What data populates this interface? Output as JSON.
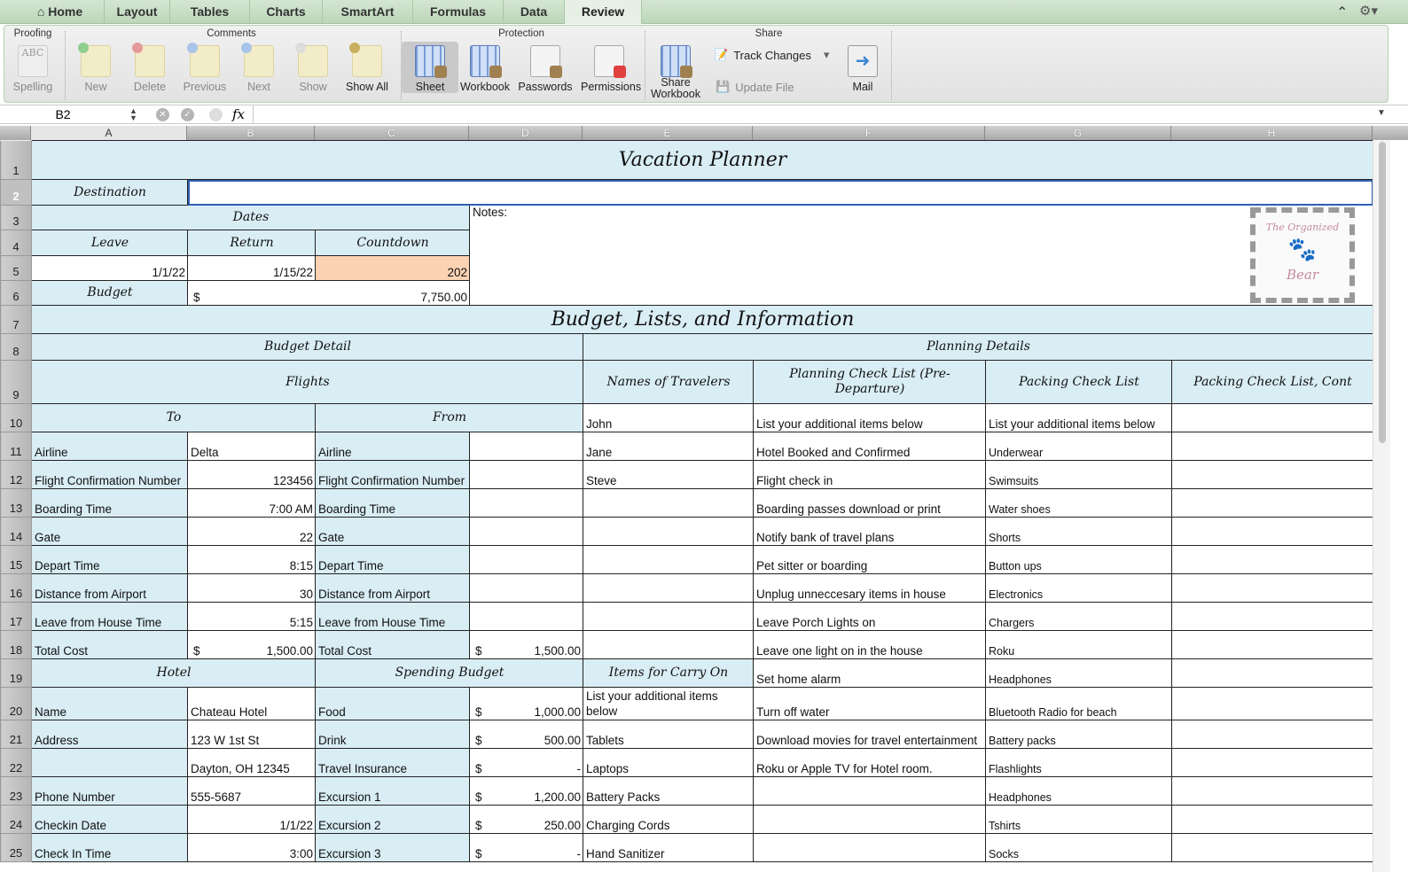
{
  "tabs": [
    "Home",
    "Layout",
    "Tables",
    "Charts",
    "SmartArt",
    "Formulas",
    "Data",
    "Review"
  ],
  "active_tab": "Review",
  "ribbon": {
    "groups": [
      "Proofing",
      "Comments",
      "Protection",
      "Share"
    ],
    "buttons": [
      "Spelling",
      "New",
      "Delete",
      "Previous",
      "Next",
      "Show",
      "Show All",
      "Sheet",
      "Workbook",
      "Passwords",
      "Permissions",
      "Share Workbook",
      "Mail"
    ],
    "track_changes": "Track Changes",
    "update_file": "Update File"
  },
  "formula_bar": {
    "name_box": "B2",
    "fx": "fx",
    "value": ""
  },
  "columns": [
    "A",
    "B",
    "C",
    "D",
    "E",
    "F",
    "G",
    "H"
  ],
  "logo": {
    "line1": "The Organized",
    "line2": "Bear"
  },
  "rows": [
    {
      "n": "1",
      "cells": [
        {
          "t": "Vacation Planner",
          "span": 8,
          "k": "t"
        }
      ]
    },
    {
      "n": "2",
      "cells": [
        {
          "t": "Destination",
          "k": "h"
        },
        {
          "t": "",
          "span": 7,
          "k": "s"
        }
      ]
    },
    {
      "n": "3",
      "cells": [
        {
          "t": "Dates",
          "span": 3,
          "k": "h"
        },
        {
          "t": "Notes:",
          "span": 5,
          "rows": 4,
          "k": "top notes"
        }
      ]
    },
    {
      "n": "4",
      "cells": [
        {
          "t": "Leave",
          "k": "h"
        },
        {
          "t": "Return",
          "k": "h"
        },
        {
          "t": "Countdown",
          "k": "h"
        }
      ]
    },
    {
      "n": "5",
      "cells": [
        {
          "t": "1/1/22",
          "k": "n"
        },
        {
          "t": "1/15/22",
          "k": "n"
        },
        {
          "t": "202",
          "k": "o"
        }
      ]
    },
    {
      "n": "6",
      "cells": [
        {
          "t": "Budget",
          "k": "h"
        },
        {
          "cur": "$",
          "t": "7,750.00",
          "span": 2,
          "k": "n"
        }
      ]
    },
    {
      "n": "7",
      "cells": [
        {
          "t": "Budget, Lists, and Information",
          "span": 8,
          "k": "t"
        }
      ]
    },
    {
      "n": "8",
      "cells": [
        {
          "t": "Budget Detail",
          "span": 4,
          "k": "h"
        },
        {
          "t": "Planning Details",
          "span": 4,
          "k": "h"
        }
      ]
    },
    {
      "n": "9",
      "cells": [
        {
          "t": "Flights",
          "span": 4,
          "k": "h"
        },
        {
          "t": "Names of Travelers",
          "k": "h"
        },
        {
          "t": "Planning Check List (Pre-Departure)",
          "k": "h wrap"
        },
        {
          "t": "Packing Check List",
          "k": "h"
        },
        {
          "t": "Packing Check List, Cont",
          "k": "h"
        }
      ]
    },
    {
      "n": "10",
      "cells": [
        {
          "t": "To",
          "span": 2,
          "k": "h"
        },
        {
          "t": "From",
          "span": 2,
          "k": "h"
        },
        {
          "t": "John"
        },
        {
          "t": "List your additional items below"
        },
        {
          "t": "List your additional items below"
        },
        {
          "t": ""
        }
      ]
    },
    {
      "n": "11",
      "cells": [
        {
          "t": "Airline",
          "k": "b"
        },
        {
          "t": "Delta"
        },
        {
          "t": "Airline",
          "k": "b"
        },
        {
          "t": ""
        },
        {
          "t": "Jane"
        },
        {
          "t": "Hotel Booked and Confirmed"
        },
        {
          "t": "Underwear",
          "k": "g"
        },
        {
          "t": ""
        }
      ]
    },
    {
      "n": "12",
      "cells": [
        {
          "t": "Flight Confirmation Number",
          "k": "b"
        },
        {
          "t": "123456",
          "k": "n"
        },
        {
          "t": "Flight Confirmation Number",
          "k": "b"
        },
        {
          "t": ""
        },
        {
          "t": "Steve"
        },
        {
          "t": "Flight check in"
        },
        {
          "t": "Swimsuits",
          "k": "g"
        },
        {
          "t": ""
        }
      ]
    },
    {
      "n": "13",
      "cells": [
        {
          "t": "Boarding Time",
          "k": "b"
        },
        {
          "t": "7:00 AM",
          "k": "n"
        },
        {
          "t": "Boarding Time",
          "k": "b"
        },
        {
          "t": ""
        },
        {
          "t": ""
        },
        {
          "t": "Boarding passes download or print"
        },
        {
          "t": "Water shoes",
          "k": "g"
        },
        {
          "t": ""
        }
      ]
    },
    {
      "n": "14",
      "cells": [
        {
          "t": "Gate",
          "k": "b"
        },
        {
          "t": "22",
          "k": "n"
        },
        {
          "t": "Gate",
          "k": "b"
        },
        {
          "t": ""
        },
        {
          "t": ""
        },
        {
          "t": "Notify bank of travel plans"
        },
        {
          "t": "Shorts",
          "k": "g"
        },
        {
          "t": ""
        }
      ]
    },
    {
      "n": "15",
      "cells": [
        {
          "t": "Depart Time",
          "k": "b"
        },
        {
          "t": "8:15",
          "k": "n"
        },
        {
          "t": "Depart Time",
          "k": "b"
        },
        {
          "t": ""
        },
        {
          "t": ""
        },
        {
          "t": "Pet sitter or boarding"
        },
        {
          "t": "Button ups",
          "k": "g"
        },
        {
          "t": ""
        }
      ]
    },
    {
      "n": "16",
      "cells": [
        {
          "t": "Distance from Airport",
          "k": "b"
        },
        {
          "t": "30",
          "k": "n"
        },
        {
          "t": "Distance from Airport",
          "k": "b"
        },
        {
          "t": ""
        },
        {
          "t": ""
        },
        {
          "t": "Unplug unneccesary items in house"
        },
        {
          "t": "Electronics",
          "k": "g"
        },
        {
          "t": ""
        }
      ]
    },
    {
      "n": "17",
      "cells": [
        {
          "t": "Leave from House Time",
          "k": "b"
        },
        {
          "t": "5:15",
          "k": "n"
        },
        {
          "t": "Leave from House Time",
          "k": "b"
        },
        {
          "t": ""
        },
        {
          "t": ""
        },
        {
          "t": "Leave Porch Lights on"
        },
        {
          "t": "Chargers",
          "k": "g"
        },
        {
          "t": ""
        }
      ]
    },
    {
      "n": "18",
      "cells": [
        {
          "t": "Total Cost",
          "k": "b"
        },
        {
          "cur": "$",
          "t": "1,500.00",
          "k": "n"
        },
        {
          "t": "Total Cost",
          "k": "b"
        },
        {
          "cur": "$",
          "t": "1,500.00",
          "k": "n"
        },
        {
          "t": ""
        },
        {
          "t": "Leave one light on in the house"
        },
        {
          "t": "Roku",
          "k": "g"
        },
        {
          "t": ""
        }
      ]
    },
    {
      "n": "19",
      "cells": [
        {
          "t": "Hotel",
          "span": 2,
          "k": "h"
        },
        {
          "t": "Spending Budget",
          "span": 2,
          "k": "h"
        },
        {
          "t": "Items for Carry On",
          "k": "h"
        },
        {
          "t": "Set home alarm"
        },
        {
          "t": "Headphones",
          "k": "g"
        },
        {
          "t": ""
        }
      ]
    },
    {
      "n": "20",
      "cells": [
        {
          "t": "Name",
          "k": "b"
        },
        {
          "t": "Chateau Hotel"
        },
        {
          "t": "Food",
          "k": "b"
        },
        {
          "cur": "$",
          "t": "1,000.00",
          "k": "n"
        },
        {
          "t": "List your additional items below",
          "k": "wrap"
        },
        {
          "t": "Turn off water"
        },
        {
          "t": "Bluetooth Radio for beach",
          "k": "g"
        },
        {
          "t": ""
        }
      ]
    },
    {
      "n": "21",
      "cells": [
        {
          "t": "Address",
          "k": "b"
        },
        {
          "t": "123 W 1st St"
        },
        {
          "t": "Drink",
          "k": "b"
        },
        {
          "cur": "$",
          "t": "500.00",
          "k": "n"
        },
        {
          "t": "Tablets"
        },
        {
          "t": "Download movies for travel entertainment"
        },
        {
          "t": "Battery packs",
          "k": "g"
        },
        {
          "t": ""
        }
      ]
    },
    {
      "n": "22",
      "cells": [
        {
          "t": "",
          "k": "b"
        },
        {
          "t": "Dayton, OH 12345"
        },
        {
          "t": "Travel Insurance",
          "k": "b"
        },
        {
          "cur": "$",
          "t": "-",
          "k": "n"
        },
        {
          "t": "Laptops"
        },
        {
          "t": "Roku or Apple TV for Hotel room."
        },
        {
          "t": "Flashlights",
          "k": "g"
        },
        {
          "t": ""
        }
      ]
    },
    {
      "n": "23",
      "cells": [
        {
          "t": "Phone Number",
          "k": "b"
        },
        {
          "t": "555-5687"
        },
        {
          "t": "Excursion 1",
          "k": "b"
        },
        {
          "cur": "$",
          "t": "1,200.00",
          "k": "n"
        },
        {
          "t": "Battery Packs"
        },
        {
          "t": ""
        },
        {
          "t": "Headphones",
          "k": "g"
        },
        {
          "t": ""
        }
      ]
    },
    {
      "n": "24",
      "cells": [
        {
          "t": "Checkin Date",
          "k": "b"
        },
        {
          "t": "1/1/22",
          "k": "n"
        },
        {
          "t": "Excursion 2",
          "k": "b"
        },
        {
          "cur": "$",
          "t": "250.00",
          "k": "n"
        },
        {
          "t": "Charging Cords"
        },
        {
          "t": ""
        },
        {
          "t": "Tshirts",
          "k": "g"
        },
        {
          "t": ""
        }
      ]
    },
    {
      "n": "25",
      "cells": [
        {
          "t": "Check In Time",
          "k": "b"
        },
        {
          "t": "3:00",
          "k": "n"
        },
        {
          "t": "Excursion 3",
          "k": "b"
        },
        {
          "cur": "$",
          "t": "-",
          "k": "n"
        },
        {
          "t": "Hand Sanitizer"
        },
        {
          "t": ""
        },
        {
          "t": "Socks",
          "k": "g"
        },
        {
          "t": ""
        }
      ]
    }
  ]
}
